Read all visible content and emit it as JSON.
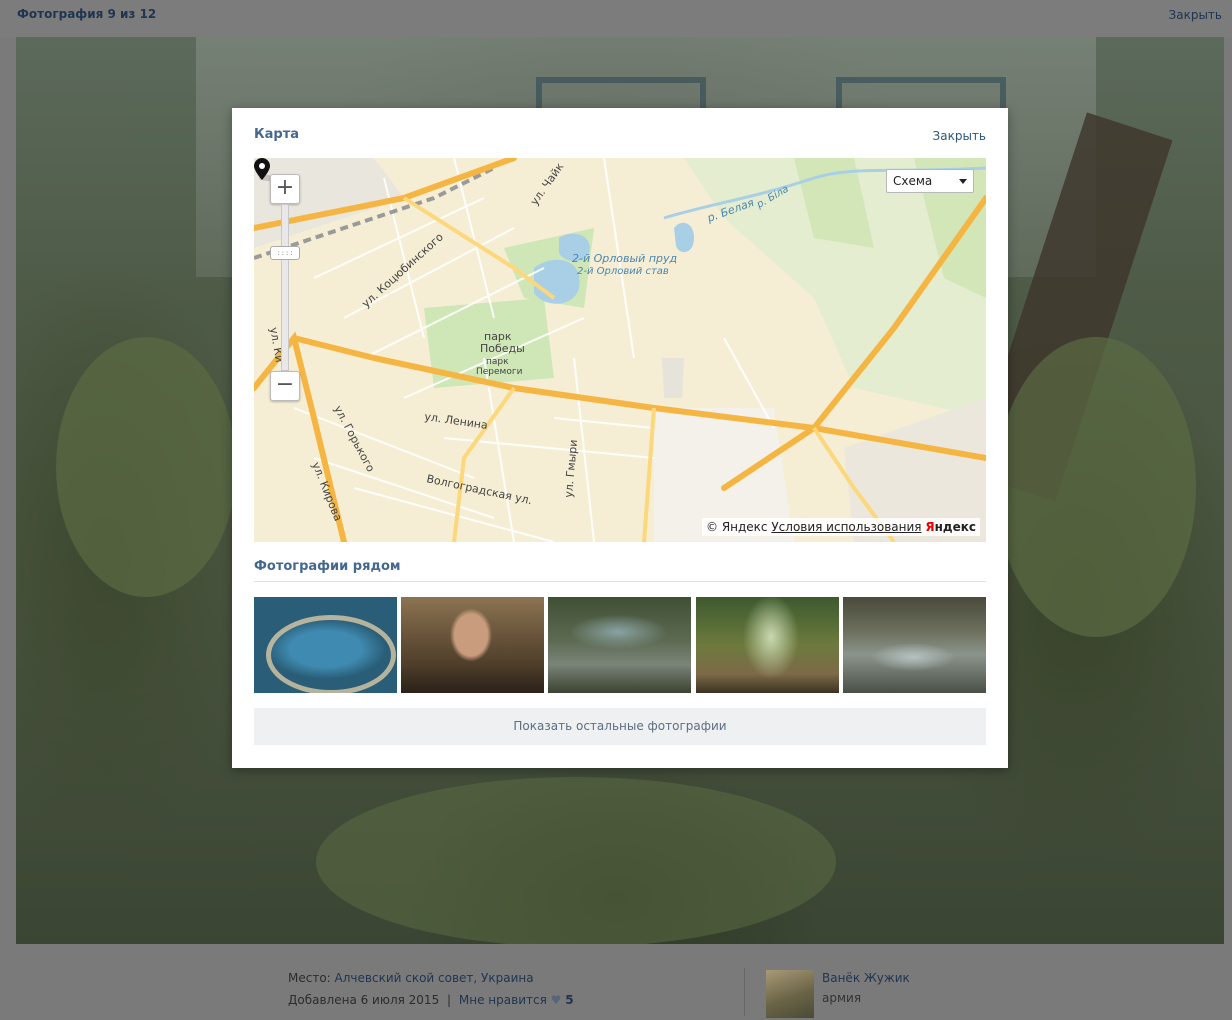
{
  "viewer": {
    "title": "Фотография 9 из 12",
    "close_label": "Закрыть"
  },
  "photo_info": {
    "place_label": "Место:",
    "place_value": "Алчевский ской совет, Украина",
    "added_label": "Добавлена 6 июля 2015",
    "separator": "|",
    "like_label": "Мне нравится",
    "like_icon": "heart-icon",
    "likes_count": "5"
  },
  "author": {
    "name": "Ванёк Жужик",
    "album": "армия"
  },
  "modal": {
    "title": "Карта",
    "close_label": "Закрыть"
  },
  "map": {
    "zoom_in_label": "+",
    "zoom_out_label": "−",
    "zoom_handle_label": "::::",
    "map_type_selected": "Схема",
    "copyright_text": "© Яндекс",
    "terms_label": "Условия использования",
    "logo_first_letter": "Я",
    "logo_rest": "ндекс",
    "labels": {
      "street_chaik": "ул. Чайк",
      "street_kotsyubinsky": "ул. Коцюбинского",
      "river_belaya_1": "р. Белая",
      "river_belaya_2": "р. Біла",
      "pond_1": "2-й Орловый пруд",
      "pond_2": "2-й Орловий став",
      "park_1": "парк",
      "park_2": "Победы",
      "park_3": "парк",
      "park_4": "Перемоги",
      "street_ki": "ул. Ки",
      "street_gorky": "ул. Горького",
      "street_lenina": "ул. Ленина",
      "street_gmyri": "ул. Гмыри",
      "street_volgogradskaya": "Волгоградская ул.",
      "street_kirova": "ул. Кирова"
    },
    "colors": {
      "land": "#f5eed4",
      "roads_major": "#f5a623",
      "water": "#a8cfe6",
      "park": "#cfe6b6"
    }
  },
  "nearby": {
    "title": "Фотографии рядом",
    "show_more_label": "Показать остальные фотографии"
  }
}
